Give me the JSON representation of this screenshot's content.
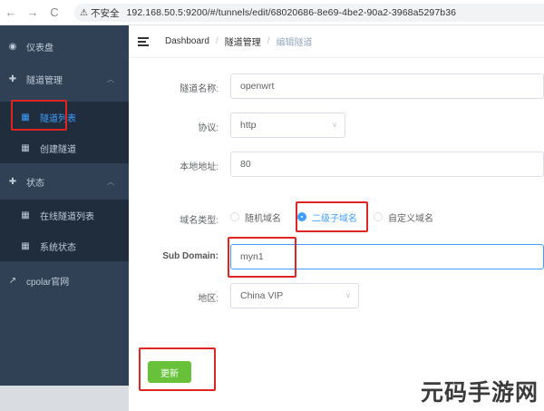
{
  "browser": {
    "insecure_label": "不安全",
    "url": "192.168.50.5:9200/#/tunnels/edit/68020686-8e69-4be2-90a2-3968a5297b36"
  },
  "sidebar": {
    "items": [
      {
        "label": "仪表盘",
        "icon": "dashboard-icon"
      },
      {
        "label": "隧道管理",
        "icon": "plus-circle-icon",
        "expanded": true
      },
      {
        "label": "隧道列表",
        "icon": "grid-icon",
        "active": true
      },
      {
        "label": "创建隧道",
        "icon": "grid-icon"
      },
      {
        "label": "状态",
        "icon": "plus-circle-icon",
        "expanded": true
      },
      {
        "label": "在线隧道列表",
        "icon": "grid-icon"
      },
      {
        "label": "系统状态",
        "icon": "grid-icon"
      },
      {
        "label": "cpolar官网",
        "icon": "external-link-icon"
      }
    ]
  },
  "header": {
    "breadcrumb": [
      "Dashboard",
      "隧道管理",
      "编辑隧道"
    ]
  },
  "form": {
    "tunnel_name": {
      "label": "隧道名称:",
      "value": "openwrt"
    },
    "protocol": {
      "label": "协议:",
      "value": "http"
    },
    "local_address": {
      "label": "本地地址:",
      "value": "80"
    },
    "domain_type": {
      "label": "域名类型:",
      "options": [
        "随机域名",
        "二级子域名",
        "自定义域名"
      ],
      "selected": "二级子域名"
    },
    "sub_domain": {
      "label": "Sub Domain:",
      "value": "myn1"
    },
    "region": {
      "label": "地区:",
      "value": "China VIP"
    },
    "save_label": "更新"
  },
  "colors": {
    "sidebar_bg": "#304156",
    "accent": "#409eff",
    "highlight": "#e02424",
    "save_button": "#67c23a"
  },
  "watermark": "元码手游网"
}
